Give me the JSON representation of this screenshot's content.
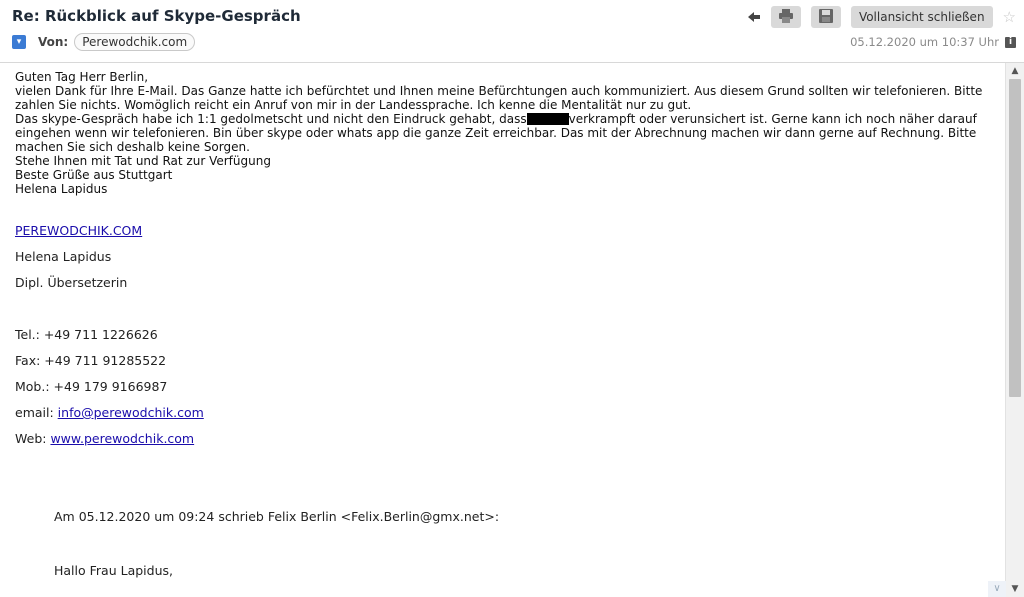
{
  "email": {
    "subject": "Re: Rückblick auf Skype-Gespräch",
    "from_label": "Von:",
    "sender": "Perewodchik.com",
    "date": "05.12.2020 um 10:37 Uhr"
  },
  "toolbar": {
    "close_fullview_label": "Vollansicht schließen"
  },
  "body": {
    "greeting": "Guten Tag Herr Berlin,",
    "para1": "vielen Dank für Ihre E-Mail. Das Ganze hatte ich befürchtet und Ihnen meine Befürchtungen auch kommuniziert. Aus diesem Grund sollten wir telefonieren. Bitte zahlen Sie nichts. Womöglich reicht ein Anruf von mir in der Landessprache. Ich kenne die Mentalität nur zu gut.",
    "para2_before": "Das skype-Gespräch habe ich 1:1 gedolmetscht und nicht den Eindruck gehabt, dass",
    "para2_after": "verkrampft oder verunsichert ist. Gerne kann ich noch näher darauf eingehen wenn wir telefonieren. Bin über skype oder whats app die ganze Zeit erreichbar. Das mit der Abrechnung machen wir dann gerne auf Rechnung. Bitte machen Sie sich deshalb keine Sorgen.",
    "line_support": "Stehe Ihnen mit Tat und Rat zur Verfügung",
    "line_regards": "Beste Grüße aus Stuttgart",
    "line_name": "Helena Lapidus"
  },
  "signature": {
    "site": "PEREWODCHIK.COM",
    "name": "Helena Lapidus",
    "title": "Dipl. Übersetzerin",
    "tel": "Tel.: +49 711 1226626",
    "fax": "Fax: +49 711 91285522",
    "mob": "Mob.: +49 179 9166987",
    "email_label": "email:",
    "email": "info@perewodchik.com",
    "web_label": "Web:",
    "web": "www.perewodchik.com"
  },
  "quoted": {
    "header": "Am 05.12.2020 um 09:24 schrieb Felix Berlin <Felix.Berlin@gmx.net>:",
    "greeting": "Hallo Frau Lapidus,"
  },
  "icons": [
    "expand-icon",
    "back-arrow-icon",
    "print-icon",
    "save-icon",
    "star-icon",
    "info-icon",
    "scroll-up-icon",
    "scroll-down-icon"
  ]
}
